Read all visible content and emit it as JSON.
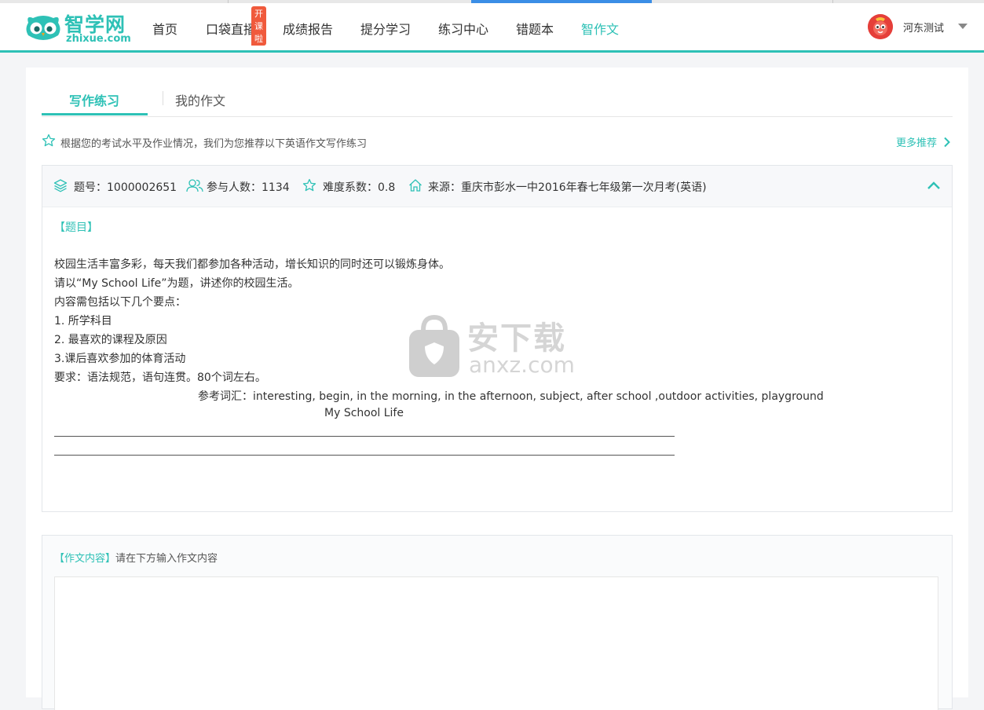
{
  "app": {
    "logo_text": "智学网",
    "logo_sub": "zhixue.com"
  },
  "nav": {
    "items": [
      {
        "label": "首页"
      },
      {
        "label": "口袋直播"
      },
      {
        "label": "成绩报告"
      },
      {
        "label": "提分学习"
      },
      {
        "label": "练习中心"
      },
      {
        "label": "错题本"
      },
      {
        "label": "智作文"
      }
    ],
    "active": "智作文",
    "badge": "开课啦"
  },
  "user": {
    "name": "河东测试"
  },
  "tabs": [
    {
      "label": "写作练习",
      "active": true
    },
    {
      "label": "我的作文",
      "active": false
    }
  ],
  "recommend": {
    "text": "根据您的考试水平及作业情况，我们为您推荐以下英语作文写作练习",
    "more": "更多推荐"
  },
  "question": {
    "id_label": "题号：1000002651",
    "participants_label": "参与人数：1134",
    "difficulty_label": "难度系数：0.8",
    "source_label": "来源：重庆市彭水一中2016年春七年级第一次月考(英语)",
    "tag": "【题目】",
    "lines": [
      "校园生活丰富多彩，每天我们都参加各种活动，增长知识的同时还可以锻炼身体。",
      "请以“My School Life”为题，讲述你的校园生活。",
      "内容需包括以下几个要点：",
      "1. 所学科目",
      "2. 最喜欢的课程及原因",
      "3.课后喜欢参加的体育活动",
      "要求：语法规范，语句连贯。80个词左右。"
    ],
    "vocab": "参考词汇：interesting, begin, in the morning, in the afternoon, subject, after school ,outdoor activities, playground",
    "essay_title": "My School Life"
  },
  "answer": {
    "tag": "【作文内容】",
    "hint": "请在下方输入作文内容",
    "value": ""
  },
  "watermark": {
    "text": "安下载",
    "sub": "anxz.com"
  },
  "colors": {
    "accent": "#2ec1b6",
    "badge": "#f05a3c",
    "loadbar": "#3b8ee6"
  }
}
